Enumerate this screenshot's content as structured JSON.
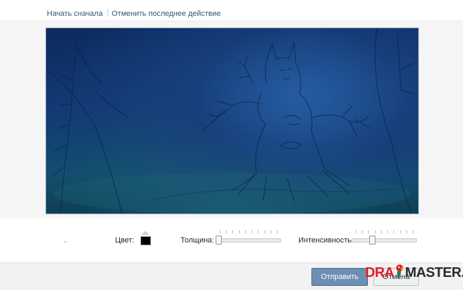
{
  "top_links": {
    "start_over": "Начать сначала",
    "undo_last": "Отменить последнее действие"
  },
  "toolbar": {
    "color_label": "Цвет:",
    "color_value": "#000000",
    "thickness_label": "Толщина:",
    "thickness_level": 0.0,
    "intensity_label": "Интенсивность:",
    "intensity_level": 0.3
  },
  "footer": {
    "send_label": "Отправить",
    "cancel_label": "Отмена"
  },
  "watermark": {
    "part1": "DRA",
    "part2": "MASTER.RU"
  },
  "colors": {
    "link": "#2b587a",
    "send_button": "#6d8fb3",
    "watermark_red": "#e21c24"
  },
  "icons": [
    "color-picker-arrow-icon",
    "parrot-logo-icon"
  ]
}
